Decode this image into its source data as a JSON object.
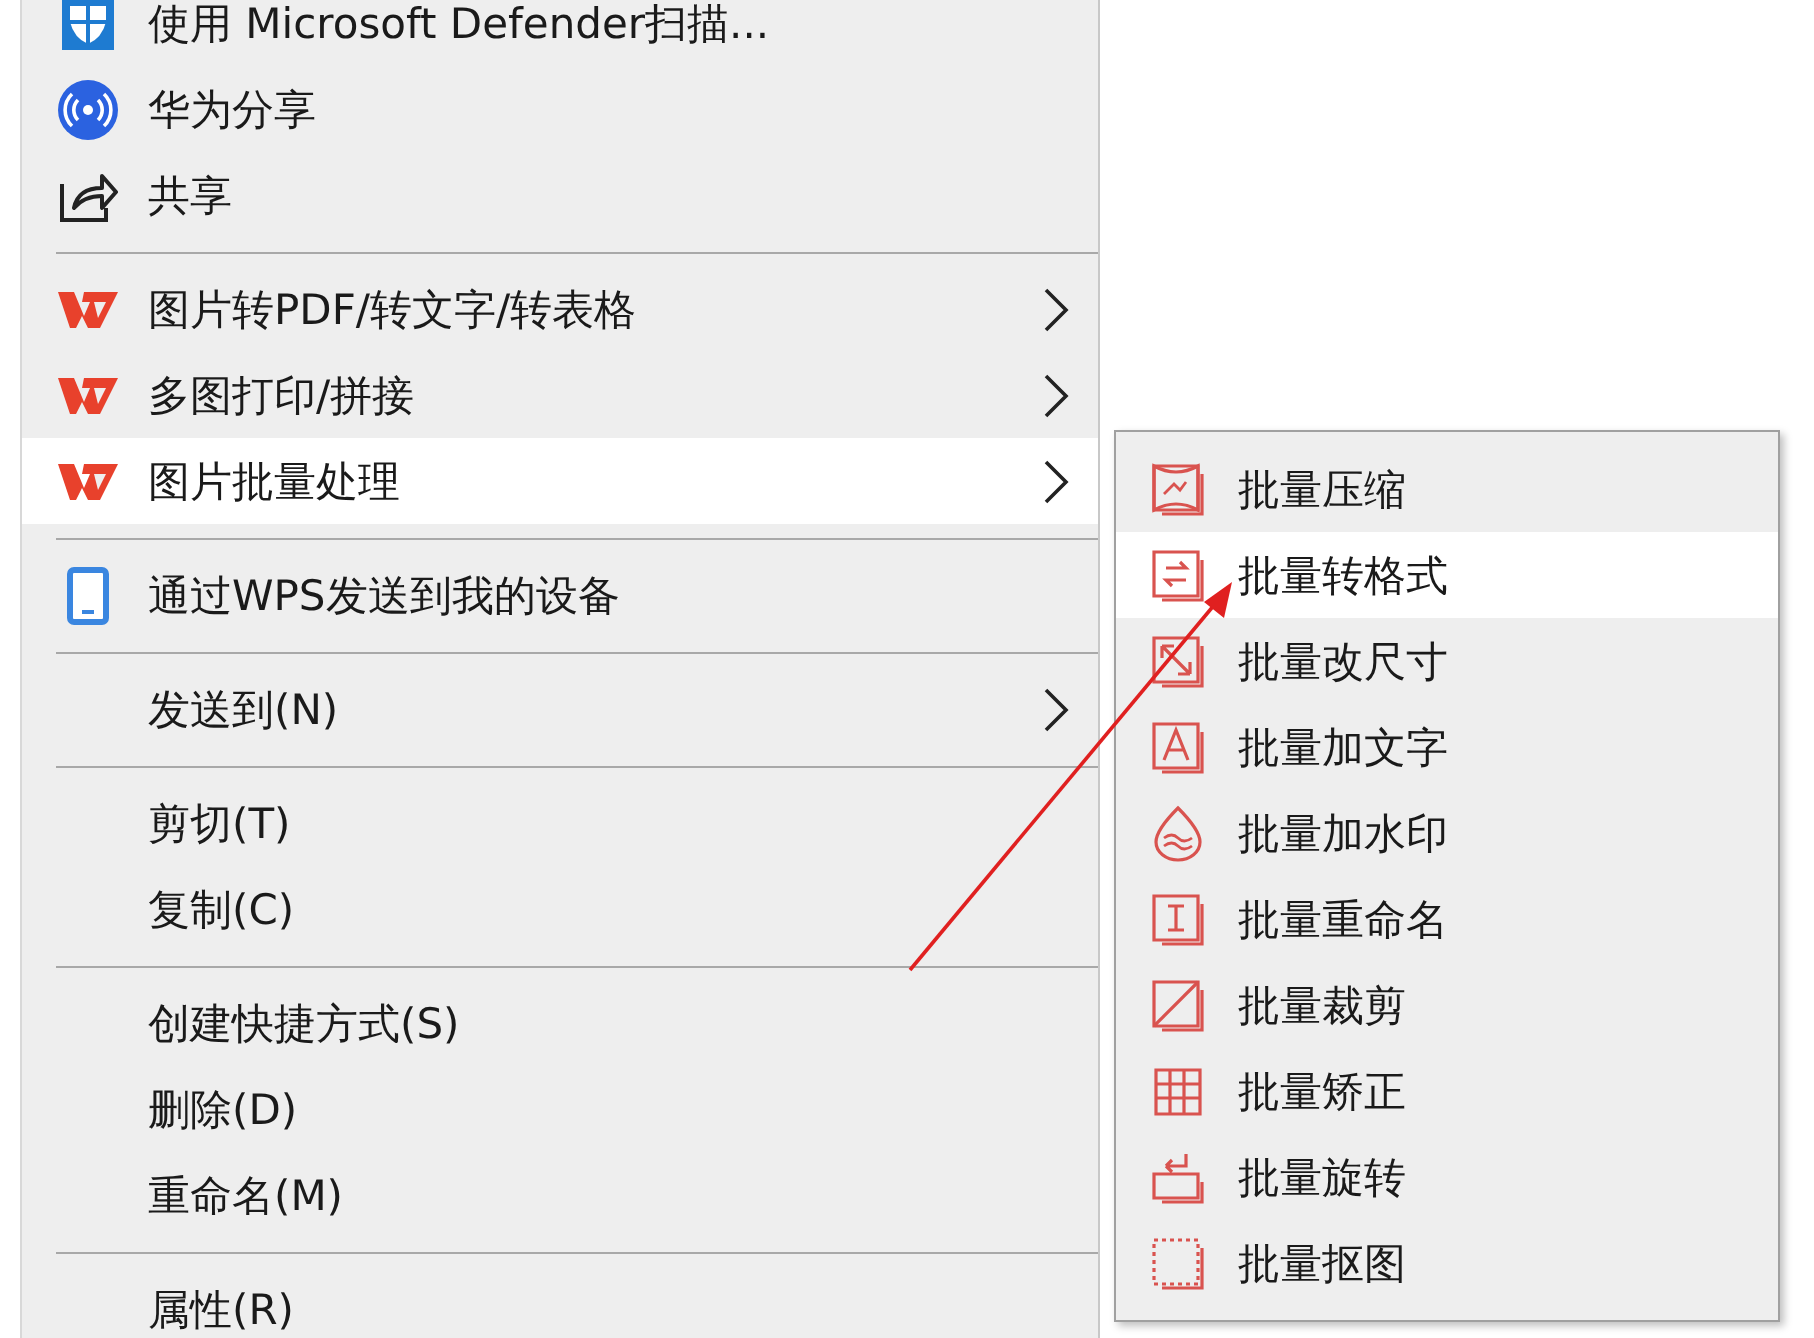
{
  "menu": {
    "items": [
      {
        "kind": "defender",
        "label": "使用 Microsoft Defender扫描...",
        "has_submenu": false,
        "selected": false
      },
      {
        "kind": "huawei",
        "label": "华为分享",
        "has_submenu": false,
        "selected": false
      },
      {
        "kind": "share",
        "label": "共享",
        "has_submenu": false,
        "selected": false
      },
      {
        "kind": "separator"
      },
      {
        "kind": "wps",
        "label": "图片转PDF/转文字/转表格",
        "has_submenu": true,
        "selected": false
      },
      {
        "kind": "wps",
        "label": "多图打印/拼接",
        "has_submenu": true,
        "selected": false
      },
      {
        "kind": "wps",
        "label": "图片批量处理",
        "has_submenu": true,
        "selected": true
      },
      {
        "kind": "separator"
      },
      {
        "kind": "device",
        "label": "通过WPS发送到我的设备",
        "has_submenu": false,
        "selected": false
      },
      {
        "kind": "separator"
      },
      {
        "kind": "plain",
        "label": "发送到(N)",
        "has_submenu": true,
        "selected": false
      },
      {
        "kind": "separator"
      },
      {
        "kind": "plain",
        "label": "剪切(T)",
        "has_submenu": false,
        "selected": false
      },
      {
        "kind": "plain",
        "label": "复制(C)",
        "has_submenu": false,
        "selected": false
      },
      {
        "kind": "separator"
      },
      {
        "kind": "plain",
        "label": "创建快捷方式(S)",
        "has_submenu": false,
        "selected": false
      },
      {
        "kind": "plain",
        "label": "删除(D)",
        "has_submenu": false,
        "selected": false
      },
      {
        "kind": "plain",
        "label": "重命名(M)",
        "has_submenu": false,
        "selected": false
      },
      {
        "kind": "separator"
      },
      {
        "kind": "plain",
        "label": "属性(R)",
        "has_submenu": false,
        "selected": false
      }
    ]
  },
  "submenu": {
    "items": [
      {
        "kind": "compress",
        "label": "批量压缩",
        "selected": false
      },
      {
        "kind": "convert",
        "label": "批量转格式",
        "selected": true
      },
      {
        "kind": "resize",
        "label": "批量改尺寸",
        "selected": false
      },
      {
        "kind": "text",
        "label": "批量加文字",
        "selected": false
      },
      {
        "kind": "watermark",
        "label": "批量加水印",
        "selected": false
      },
      {
        "kind": "rename",
        "label": "批量重命名",
        "selected": false
      },
      {
        "kind": "crop",
        "label": "批量裁剪",
        "selected": false
      },
      {
        "kind": "correct",
        "label": "批量矫正",
        "selected": false
      },
      {
        "kind": "rotate",
        "label": "批量旋转",
        "selected": false
      },
      {
        "kind": "cutout",
        "label": "批量抠图",
        "selected": false
      }
    ]
  }
}
